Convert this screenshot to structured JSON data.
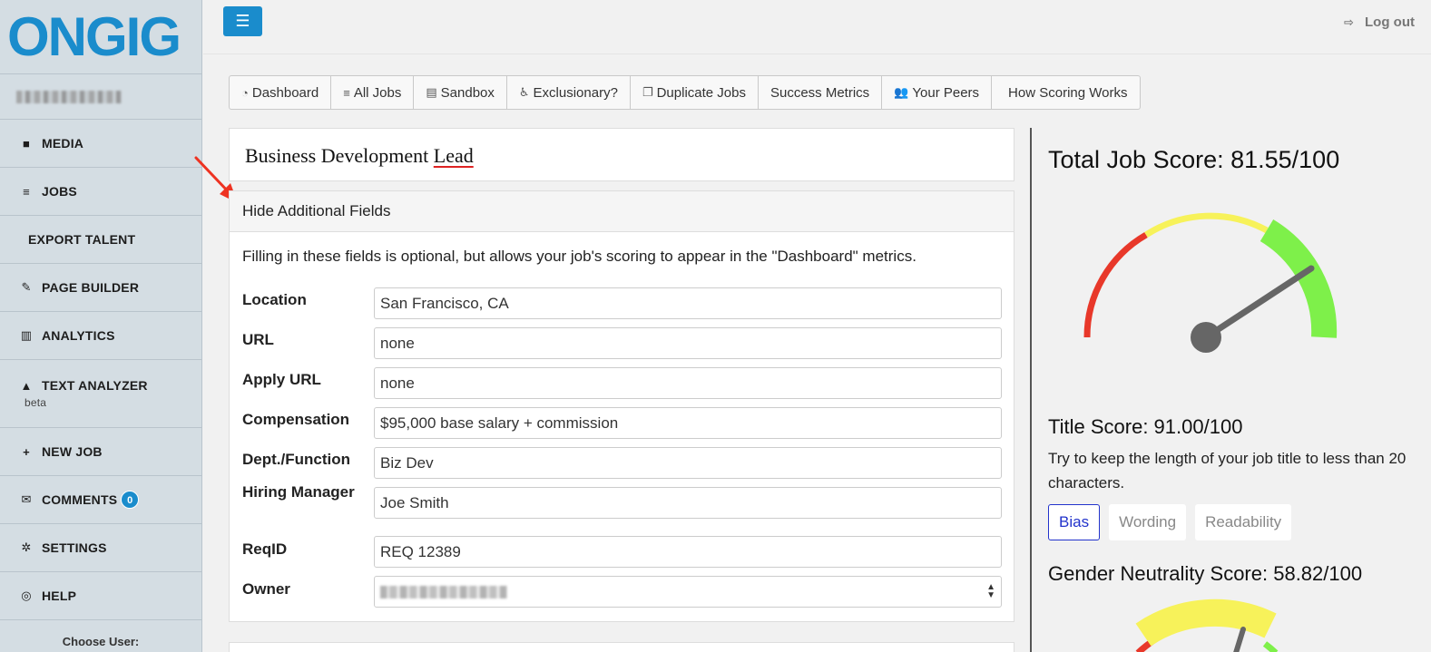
{
  "brand": {
    "logo_text": "ONGIG",
    "accent": "#1a8ccc"
  },
  "sidebar": {
    "items": [
      {
        "icon": "video-camera-icon",
        "label": "MEDIA"
      },
      {
        "icon": "list-icon",
        "label": "JOBS"
      },
      {
        "icon": "",
        "label": "EXPORT TALENT"
      },
      {
        "icon": "wrench-icon",
        "label": "PAGE BUILDER"
      },
      {
        "icon": "bar-chart-icon",
        "label": "ANALYTICS"
      },
      {
        "icon": "graduation-cap-icon",
        "label": "TEXT ANALYZER",
        "sublabel": "beta"
      },
      {
        "icon": "plus-icon",
        "label": "NEW JOB"
      },
      {
        "icon": "envelope-icon",
        "label": "COMMENTS",
        "badge": "0"
      },
      {
        "icon": "gear-icon",
        "label": "SETTINGS"
      },
      {
        "icon": "life-ring-icon",
        "label": "HELP"
      }
    ],
    "choose_user": "Choose User:"
  },
  "header": {
    "logout_label": "Log out"
  },
  "tabs": [
    {
      "icon": "dashboard-icon",
      "label": "Dashboard"
    },
    {
      "icon": "list-icon",
      "label": "All Jobs"
    },
    {
      "icon": "newspaper-icon",
      "label": "Sandbox"
    },
    {
      "icon": "wheelchair-icon",
      "label": "Exclusionary?"
    },
    {
      "icon": "copy-icon",
      "label": "Duplicate Jobs"
    },
    {
      "icon": "",
      "label": "Success Metrics"
    },
    {
      "icon": "users-icon",
      "label": "Your Peers"
    },
    {
      "icon": "",
      "label": "How Scoring Works"
    }
  ],
  "job": {
    "title_part1": "Business Development ",
    "title_part2": "Lead"
  },
  "fields": {
    "toggle_label": "Hide Additional Fields",
    "note": "Filling in these fields is optional, but allows your job's scoring to appear in the \"Dashboard\" metrics.",
    "rows": [
      {
        "label": "Location",
        "value": "San Francisco, CA"
      },
      {
        "label": "URL",
        "value": "none"
      },
      {
        "label": "Apply URL",
        "value": "none"
      },
      {
        "label": "Compensation",
        "value": "$95,000 base salary + commission"
      },
      {
        "label": "Dept./Function",
        "value": "Biz Dev"
      },
      {
        "label": "Hiring Manager",
        "value": "Joe Smith"
      },
      {
        "label": "ReqID",
        "value": "REQ 12389"
      },
      {
        "label": "Owner",
        "value": ""
      }
    ]
  },
  "scores": {
    "total": "Total Job Score: 81.55/100",
    "total_value": 81.55,
    "title": "Title Score: 91.00/100",
    "title_tip": "Try to keep the length of your job title to less than 20 characters.",
    "pills": [
      "Bias",
      "Wording",
      "Readability"
    ],
    "active_pill": "Bias",
    "gender": "Gender Neutrality Score: 58.82/100",
    "gender_value": 58.82,
    "colors": {
      "red": "#e8382a",
      "yellow": "#f7f25a",
      "green": "#7ef04a",
      "needle": "#666666"
    }
  }
}
